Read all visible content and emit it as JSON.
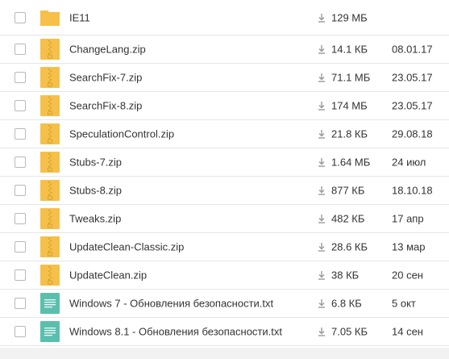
{
  "files": [
    {
      "name": "IE11",
      "size": "129 МБ",
      "date": "",
      "icon": "folder-icon"
    },
    {
      "name": "ChangeLang.zip",
      "size": "14.1 КБ",
      "date": "08.01.17",
      "icon": "zip-file-icon"
    },
    {
      "name": "SearchFix-7.zip",
      "size": "71.1 МБ",
      "date": "23.05.17",
      "icon": "zip-file-icon"
    },
    {
      "name": "SearchFix-8.zip",
      "size": "174 МБ",
      "date": "23.05.17",
      "icon": "zip-file-icon"
    },
    {
      "name": "SpeculationControl.zip",
      "size": "21.8 КБ",
      "date": "29.08.18",
      "icon": "zip-file-icon"
    },
    {
      "name": "Stubs-7.zip",
      "size": "1.64 МБ",
      "date": "24 июл",
      "icon": "zip-file-icon"
    },
    {
      "name": "Stubs-8.zip",
      "size": "877 КБ",
      "date": "18.10.18",
      "icon": "zip-file-icon"
    },
    {
      "name": "Tweaks.zip",
      "size": "482 КБ",
      "date": "17 апр",
      "icon": "zip-file-icon"
    },
    {
      "name": "UpdateClean-Classic.zip",
      "size": "28.6 КБ",
      "date": "13 мар",
      "icon": "zip-file-icon"
    },
    {
      "name": "UpdateClean.zip",
      "size": "38 КБ",
      "date": "20 сен",
      "icon": "zip-file-icon"
    },
    {
      "name": "Windows 7 - Обновления безопасности.txt",
      "size": "6.8 КБ",
      "date": "5 окт",
      "icon": "text-file-icon"
    },
    {
      "name": "Windows 8.1 - Обновления безопасности.txt",
      "size": "7.05 КБ",
      "date": "14 сен",
      "icon": "text-file-icon"
    }
  ],
  "colors": {
    "folder": "#f5c04a",
    "zip": "#f5c04a",
    "zip_stripe": "#d9a12c",
    "text_file": "#5bbfae",
    "download_icon": "#9a9a9a",
    "row_border": "#e6e6e6"
  }
}
